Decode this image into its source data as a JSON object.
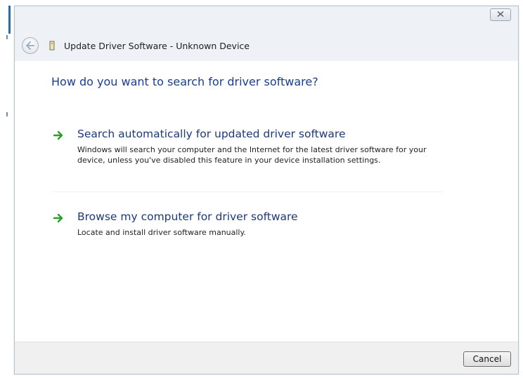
{
  "window": {
    "title": "Update Driver Software - Unknown Device",
    "close_label": "⊠"
  },
  "main": {
    "question": "How do you want to search for driver software?",
    "options": [
      {
        "title": "Search automatically for updated driver software",
        "description": "Windows will search your computer and the Internet for the latest driver software for your device, unless you've disabled this feature in your device installation settings.",
        "icon": "green-arrow-icon"
      },
      {
        "title": "Browse my computer for driver software",
        "description": "Locate and install driver software manually.",
        "icon": "green-arrow-icon"
      }
    ]
  },
  "footer": {
    "cancel_label": "Cancel"
  },
  "colors": {
    "heading_blue": "#1a3d8f",
    "option_blue": "#1b3a7a",
    "arrow_green": "#2e9d2e",
    "footer_bg": "#f0f0f0"
  }
}
